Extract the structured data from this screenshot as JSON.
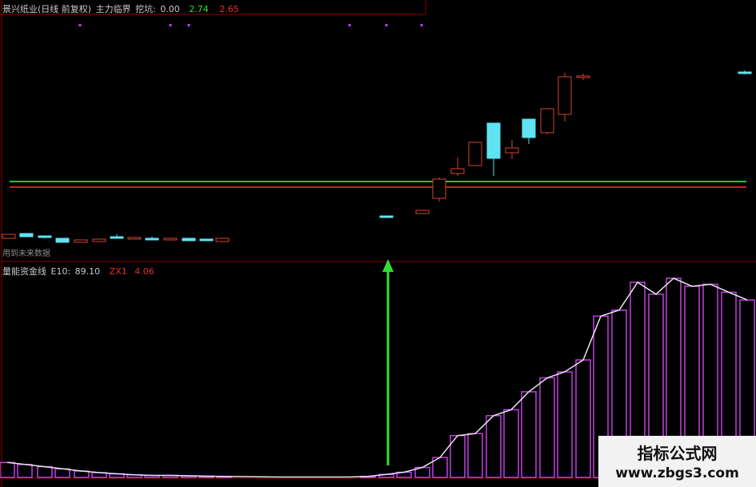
{
  "header_top": {
    "title": "景兴纸业(日线 前复权)",
    "indicator": "主力临界",
    "label_waken": "挖坑:",
    "value_waken": "0.00",
    "value_green": "2.74",
    "value_red": "2.65"
  },
  "header_bottom": {
    "indicator": "量能资金线",
    "e10_label": "E10:",
    "e10_value": "89.10",
    "zx_label": "ZX1",
    "zx_value": "4.06"
  },
  "note": "用到未来数据",
  "watermark": {
    "title": "指标公式网",
    "url": "www.zbgs3.com"
  },
  "colors": {
    "background": "#000000",
    "border": "#8b0000",
    "green_line": "#1fcc1f",
    "red_line": "#cc1f1f",
    "candle_up": "#d4432f",
    "candle_down": "#5fe3f3",
    "volume_bar": "#c040e0",
    "e10_line": "#e8e8e8",
    "arrow": "#30e030",
    "dot": "#c040e0",
    "header_green": "#30e030",
    "header_red": "#e03030"
  },
  "chart_data": [
    {
      "type": "candlestick",
      "panel": "main",
      "title": "景兴纸业(日线 前复权)",
      "ylim": [
        0,
        30
      ],
      "reference_lines": [
        {
          "name": "green",
          "value": 9.5
        },
        {
          "name": "red",
          "value": 8.8
        }
      ],
      "signal_dots_x": [
        100,
        213,
        236,
        437,
        483,
        527
      ],
      "candles": [
        {
          "x": 11,
          "open": 2.4,
          "close": 2.9,
          "high": 2.9,
          "low": 2.4
        },
        {
          "x": 33,
          "open": 3.0,
          "close": 2.6,
          "high": 3.0,
          "low": 2.6
        },
        {
          "x": 56,
          "open": 2.7,
          "close": 2.5,
          "high": 2.7,
          "low": 2.4
        },
        {
          "x": 78,
          "open": 2.4,
          "close": 1.9,
          "high": 2.4,
          "low": 1.9
        },
        {
          "x": 101,
          "open": 1.9,
          "close": 2.2,
          "high": 2.2,
          "low": 1.9
        },
        {
          "x": 124,
          "open": 2.0,
          "close": 2.3,
          "high": 2.3,
          "low": 2.0
        },
        {
          "x": 146,
          "open": 2.6,
          "close": 2.5,
          "high": 2.9,
          "low": 2.4
        },
        {
          "x": 168,
          "open": 2.3,
          "close": 2.5,
          "high": 2.5,
          "low": 2.3
        },
        {
          "x": 190,
          "open": 2.4,
          "close": 2.3,
          "high": 2.6,
          "low": 2.2
        },
        {
          "x": 213,
          "open": 2.2,
          "close": 2.4,
          "high": 2.4,
          "low": 2.2
        },
        {
          "x": 236,
          "open": 2.4,
          "close": 2.1,
          "high": 2.4,
          "low": 2.1
        },
        {
          "x": 258,
          "open": 2.3,
          "close": 2.1,
          "high": 2.3,
          "low": 2.1
        },
        {
          "x": 278,
          "open": 2.0,
          "close": 2.4,
          "high": 2.4,
          "low": 2.0
        },
        {
          "x": 483,
          "open": 5.2,
          "close": 5.0,
          "high": 5.2,
          "low": 5.0
        },
        {
          "x": 528,
          "open": 5.5,
          "close": 5.9,
          "high": 5.9,
          "low": 5.5
        },
        {
          "x": 549,
          "open": 7.4,
          "close": 9.8,
          "high": 10.0,
          "low": 7.0
        },
        {
          "x": 572,
          "open": 10.5,
          "close": 11.1,
          "high": 12.5,
          "low": 10.2
        },
        {
          "x": 594,
          "open": 11.5,
          "close": 14.4,
          "high": 14.4,
          "low": 11.5
        },
        {
          "x": 617,
          "open": 16.8,
          "close": 12.4,
          "high": 16.8,
          "low": 10.2
        },
        {
          "x": 640,
          "open": 13.1,
          "close": 13.7,
          "high": 14.7,
          "low": 12.3
        },
        {
          "x": 661,
          "open": 17.3,
          "close": 15.0,
          "high": 17.3,
          "low": 14.2
        },
        {
          "x": 684,
          "open": 15.6,
          "close": 18.6,
          "high": 18.6,
          "low": 15.4
        },
        {
          "x": 706,
          "open": 17.9,
          "close": 22.6,
          "high": 23.1,
          "low": 17.0
        },
        {
          "x": 729,
          "open": 22.5,
          "close": 22.7,
          "high": 23.0,
          "low": 22.2
        },
        {
          "x": 931,
          "open": 23.2,
          "close": 23.0,
          "high": 23.4,
          "low": 22.9
        }
      ]
    },
    {
      "type": "bar",
      "panel": "volume",
      "title": "量能资金线",
      "ylim": [
        0,
        100
      ],
      "series": [
        {
          "name": "E10",
          "x": [
            9,
            31,
            56,
            78,
            102,
            124,
            146,
            168,
            190,
            213,
            236,
            258,
            280,
            301,
            324,
            347,
            370,
            392,
            415,
            437,
            460,
            483,
            505,
            528,
            550,
            572,
            594,
            617,
            639,
            661,
            684,
            706,
            729,
            751,
            774,
            797,
            820,
            842,
            865,
            888,
            911,
            934
          ],
          "values": [
            7.5,
            6.5,
            5.4,
            4.3,
            3.2,
            2.4,
            1.8,
            1.3,
            1.0,
            1.0,
            0.8,
            0.6,
            0.5,
            0.4,
            0.3,
            0.2,
            0.2,
            0.2,
            0.2,
            0.2,
            0.5,
            1.5,
            2.6,
            5.0,
            10.0,
            21.0,
            22.0,
            31.0,
            34.0,
            43.0,
            50.0,
            53.0,
            59.0,
            81.0,
            84.0,
            98.0,
            92.0,
            100.0,
            96.0,
            97.0,
            93.0,
            89.1
          ]
        }
      ]
    }
  ]
}
